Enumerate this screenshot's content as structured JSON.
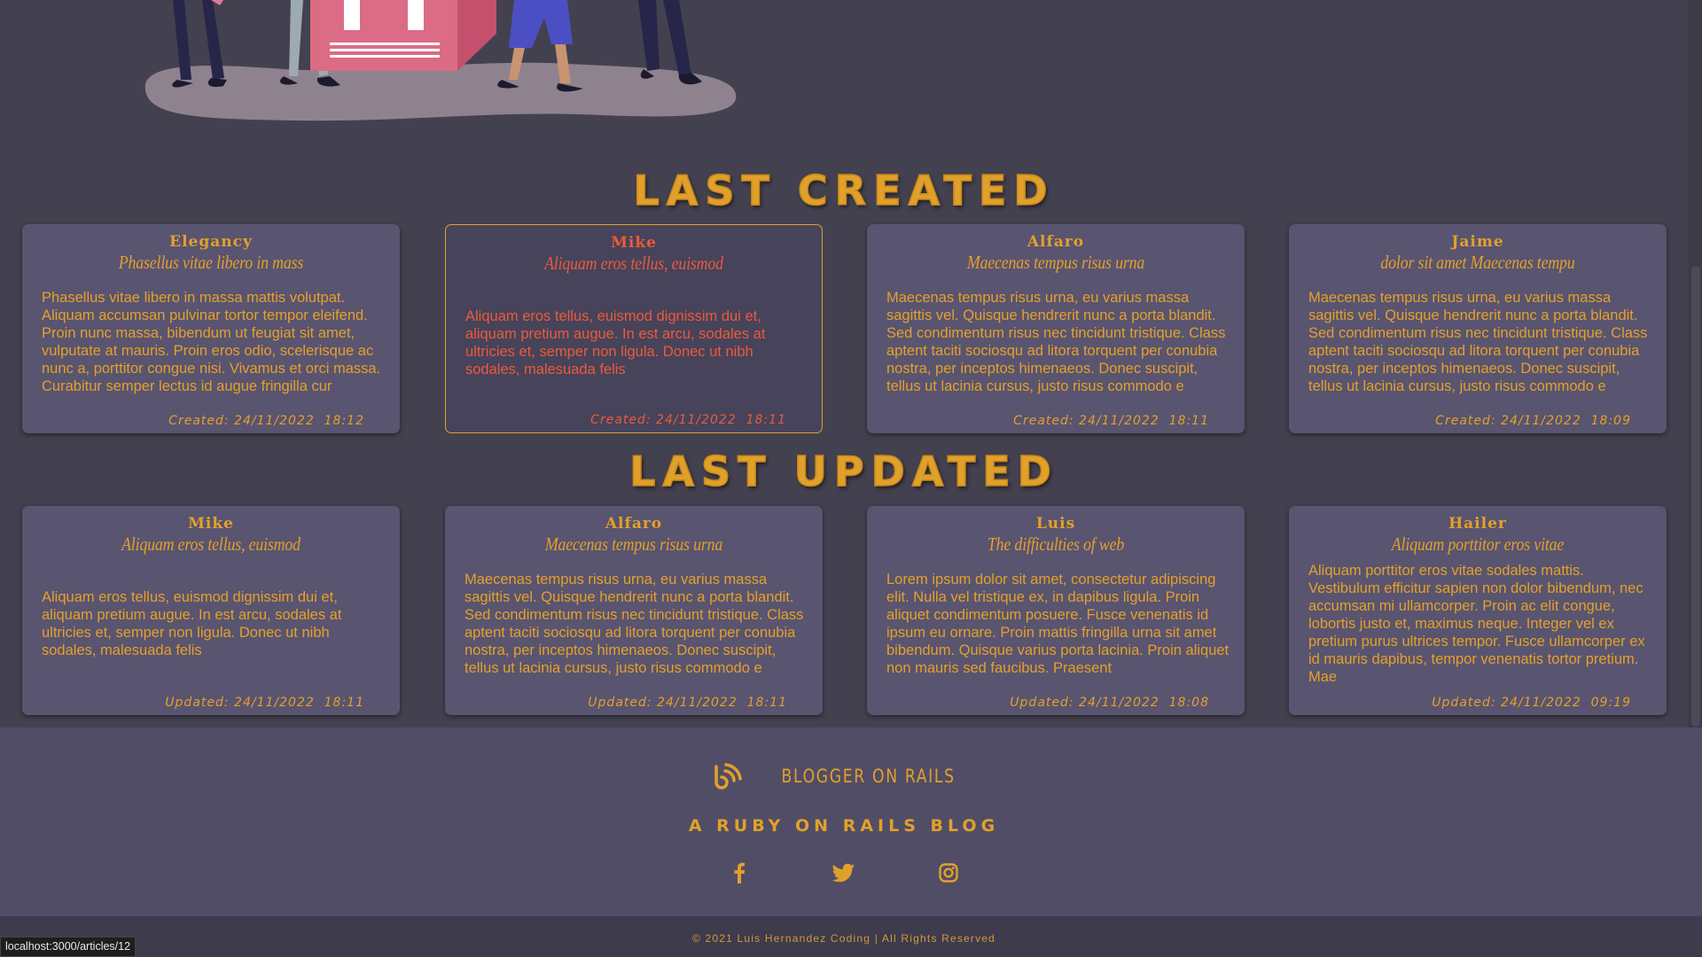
{
  "sections": {
    "last_created": "LAST CREATED",
    "last_updated": "LAST UPDATED"
  },
  "created_cards": [
    {
      "author": "Elegancy",
      "title": "Phasellus vitae libero in mass",
      "body": "Phasellus vitae libero in massa mattis volutpat. Aliquam accumsan pulvinar tortor tempor eleifend. Proin nunc massa, bibendum ut feugiat sit amet, vulputate at mauris. Proin eros odio, scelerisque ac nunc a, porttitor congue nisi. Vivamus et orci massa. Curabitur semper lectus id augue fringilla cur",
      "stamp": "Created: 24/11/2022  18:12"
    },
    {
      "author": "Mike",
      "title": "Aliquam eros tellus, euismod",
      "body": "Aliquam eros tellus, euismod dignissim dui et, aliquam pretium augue. In est arcu, sodales at ultricies et, semper non ligula. Donec ut nibh sodales, malesuada felis",
      "stamp": "Created: 24/11/2022  18:11"
    },
    {
      "author": "Alfaro",
      "title": "Maecenas tempus risus urna",
      "body": "Maecenas tempus risus urna, eu varius massa sagittis vel. Quisque hendrerit nunc a porta blandit. Sed condimentum risus nec tincidunt tristique. Class aptent taciti sociosqu ad litora torquent per conubia nostra, per inceptos himenaeos. Donec suscipit, tellus ut lacinia cursus, justo risus commodo e",
      "stamp": "Created: 24/11/2022  18:11"
    },
    {
      "author": "Jaime",
      "title": "dolor sit amet Maecenas tempu",
      "body": "Maecenas tempus risus urna, eu varius massa sagittis vel. Quisque hendrerit nunc a porta blandit. Sed condimentum risus nec tincidunt tristique. Class aptent taciti sociosqu ad litora torquent per conubia nostra, per inceptos himenaeos. Donec suscipit, tellus ut lacinia cursus, justo risus commodo e",
      "stamp": "Created: 24/11/2022  18:09"
    }
  ],
  "updated_cards": [
    {
      "author": "Mike",
      "title": "Aliquam eros tellus, euismod",
      "body": "Aliquam eros tellus, euismod dignissim dui et, aliquam pretium augue. In est arcu, sodales at ultricies et, semper non ligula. Donec ut nibh sodales, malesuada felis",
      "stamp": "Updated: 24/11/2022  18:11"
    },
    {
      "author": "Alfaro",
      "title": "Maecenas tempus risus urna",
      "body": "Maecenas tempus risus urna, eu varius massa sagittis vel. Quisque hendrerit nunc a porta blandit. Sed condimentum risus nec tincidunt tristique. Class aptent taciti sociosqu ad litora torquent per conubia nostra, per inceptos himenaeos. Donec suscipit, tellus ut lacinia cursus, justo risus commodo e",
      "stamp": "Updated: 24/11/2022  18:11"
    },
    {
      "author": "Luis",
      "title": "The difficulties of web",
      "body": "Lorem ipsum dolor sit amet, consectetur adipiscing elit. Nulla vel tristique ex, in dapibus ligula. Proin aliquet condimentum posuere. Fusce venenatis id ipsum eu ornare. Proin mattis fringilla urna sit amet bibendum. Quisque varius porta lacinia. Proin aliquet non mauris sed faucibus. Praesent",
      "stamp": "Updated: 24/11/2022  18:08"
    },
    {
      "author": "Hailer",
      "title": "Aliquam porttitor eros vitae",
      "body": "Aliquam porttitor eros vitae sodales mattis. Vestibulum efficitur sapien non dolor bibendum, nec accumsan mi ullamcorper. Proin ac elit congue, lobortis justo et, maximus neque. Integer vel ex pretium purus ultrices tempor. Fusce ullamcorper ex id mauris dapibus, tempor venenatis tortor pretium. Mae",
      "stamp": "Updated: 24/11/2022  09:19"
    }
  ],
  "footer": {
    "brand": "BLOGGER ON RAILS",
    "tagline": "A RUBY ON RAILS BLOG",
    "copyright": "© 2021 Luis Hernandez Coding | All Rights Reserved"
  },
  "icons": {
    "brand": "blog-feed-icon",
    "social": [
      "facebook-icon",
      "twitter-icon",
      "instagram-icon"
    ]
  },
  "status_bar": {
    "url": "localhost:3000/articles/12"
  },
  "colors": {
    "accent": "#e0a12a",
    "hover_text": "#ec5a3a",
    "card_bg": "#595470",
    "page_bg": "#43414f",
    "footer_bg": "#524d66"
  }
}
